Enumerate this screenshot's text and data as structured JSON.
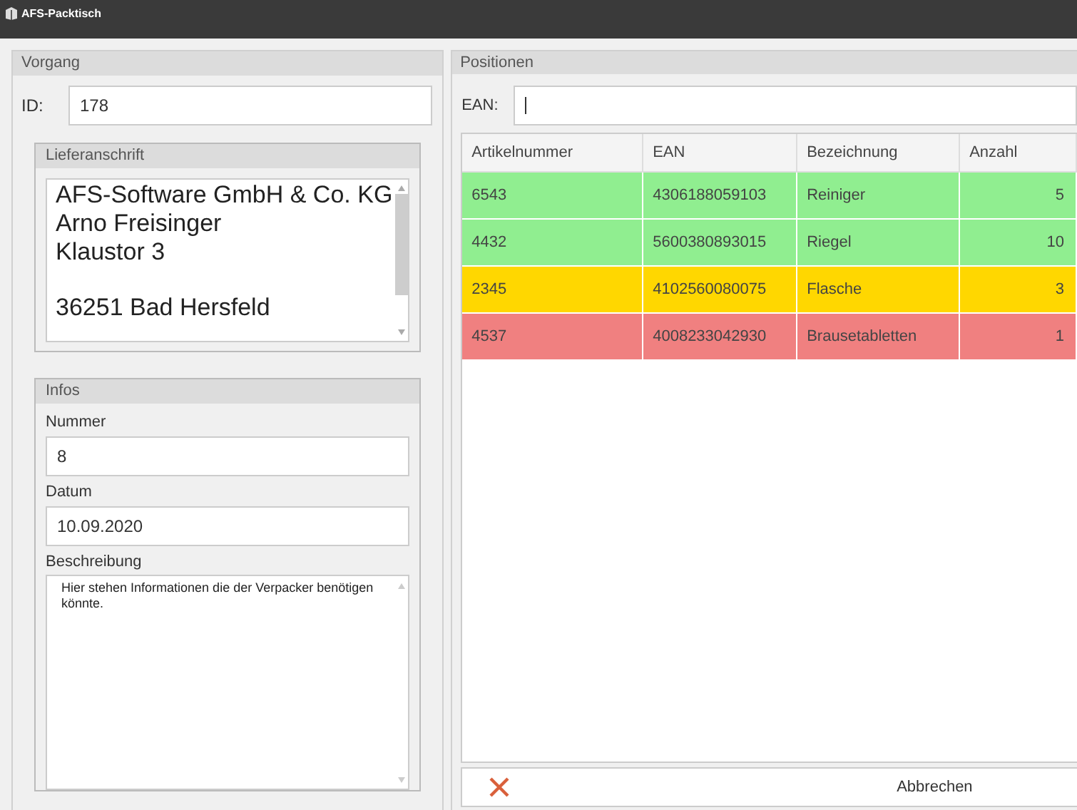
{
  "window": {
    "title": "AFS-Packtisch"
  },
  "vorgang": {
    "title": "Vorgang",
    "id_label": "ID:",
    "id_value": "178",
    "address": {
      "title": "Lieferanschrift",
      "lines": [
        "AFS-Software GmbH & Co. KG",
        "Arno Freisinger",
        "Klaustor 3"
      ],
      "city_line": "36251 Bad Hersfeld"
    },
    "infos": {
      "title": "Infos",
      "nummer_label": "Nummer",
      "nummer_value": "8",
      "datum_label": "Datum",
      "datum_value": "10.09.2020",
      "beschreibung_label": "Beschreibung",
      "beschreibung_value": "Hier stehen Informationen die der Verpacker benötigen könnte."
    }
  },
  "positionen": {
    "title": "Positionen",
    "ean_label": "EAN:",
    "table": {
      "columns": [
        "Artikelnummer",
        "EAN",
        "Bezeichnung",
        "Anzahl"
      ],
      "rows": [
        {
          "cells": [
            "6543",
            "4306188059103",
            "Reiniger",
            "5"
          ],
          "color": "#90ee90"
        },
        {
          "cells": [
            "4432",
            "5600380893015",
            "Riegel",
            "10"
          ],
          "color": "#90ee90"
        },
        {
          "cells": [
            "2345",
            "4102560080075",
            "Flasche",
            "3"
          ],
          "color": "#ffd700"
        },
        {
          "cells": [
            "4537",
            "4008233042930",
            "Brausetabletten",
            "1"
          ],
          "color": "#f08080"
        }
      ]
    },
    "cancel_button": "Abbrechen"
  }
}
